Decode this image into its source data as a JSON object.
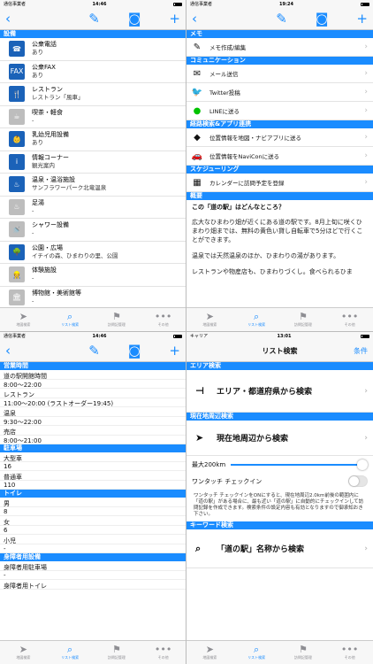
{
  "tl": {
    "status": {
      "carrier": "通信事業者",
      "time": "14:46"
    },
    "section": "設備",
    "facilities": [
      {
        "icon": "phone-icon",
        "glyph": "☎",
        "title": "公衆電話",
        "sub": "あり",
        "gray": false
      },
      {
        "icon": "fax-icon",
        "glyph": "FAX",
        "title": "公衆FAX",
        "sub": "あり",
        "gray": false
      },
      {
        "icon": "restaurant-icon",
        "glyph": "🍴",
        "title": "レストラン",
        "sub": "レストラン「風車」",
        "gray": false
      },
      {
        "icon": "cafe-icon",
        "glyph": "☕",
        "title": "喫茶・軽食",
        "sub": "-",
        "gray": true
      },
      {
        "icon": "baby-icon",
        "glyph": "👶",
        "title": "乳幼児用設備",
        "sub": "あり",
        "gray": false
      },
      {
        "icon": "info-icon",
        "glyph": "i",
        "title": "情報コーナー",
        "sub": "観光案内",
        "gray": false
      },
      {
        "icon": "onsen-icon",
        "glyph": "♨",
        "title": "温泉・温浴施設",
        "sub": "サンフラワーパーク北竜温泉",
        "gray": false
      },
      {
        "icon": "footbath-icon",
        "glyph": "♨",
        "title": "足湯",
        "sub": "-",
        "gray": true
      },
      {
        "icon": "shower-icon",
        "glyph": "🚿",
        "title": "シャワー設備",
        "sub": "-",
        "gray": true
      },
      {
        "icon": "park-icon",
        "glyph": "🌳",
        "title": "公園・広場",
        "sub": "イチイの森、ひまわりの里、公園",
        "gray": false
      },
      {
        "icon": "experience-icon",
        "glyph": "👷",
        "title": "体験施設",
        "sub": "-",
        "gray": true
      },
      {
        "icon": "museum-icon",
        "glyph": "🏛",
        "title": "博物館・美術館等",
        "sub": "-",
        "gray": true
      }
    ]
  },
  "tr": {
    "status": {
      "carrier": "通信事業者",
      "time": "19:24"
    },
    "sections": {
      "memo": "メモ",
      "communication": "コミュニケーション",
      "route": "経路検索&アプリ連携",
      "schedule": "スケジューリング",
      "summary": "概要"
    },
    "rows": {
      "memo": "メモ作成/編集",
      "mail": "メール送信",
      "twitter": "Twitter投稿",
      "line": "LINEに送る",
      "map": "位置情報を地図・ナビアプリに送る",
      "navicon": "位置情報をNaviConに送る",
      "calendar": "カレンダーに訪問予定を登録"
    },
    "summary_q": "この「道の駅」はどんなところ？",
    "paragraphs": [
      "広大なひまわり畑が近くにある道の駅です。8月上旬に咲くひまわり畑までは、無料の黄色い貸し自転車で5分ほどで行くことができます。",
      "温泉では天然温泉のほか、ひまわりの湯があります。",
      "レストランや物産店も、ひまわりづくし。食べられるひま"
    ]
  },
  "bl": {
    "status": {
      "carrier": "通信事業者",
      "time": "14:46"
    },
    "sections": {
      "hours": "営業時間",
      "parking": "駐車場",
      "toilet": "トイレ",
      "disabled": "身障者用設備"
    },
    "hours": [
      {
        "label": "道の駅開館時間",
        "value": "8:00～22:00"
      },
      {
        "label": "レストラン",
        "value": "11:00～20:00 (ラストオーダー19:45)"
      },
      {
        "label": "温泉",
        "value": "9:30～22:00"
      },
      {
        "label": "売店",
        "value": "8:00～21:00"
      }
    ],
    "parking": [
      {
        "label": "大型車",
        "value": "16"
      },
      {
        "label": "普通車",
        "value": "110"
      }
    ],
    "toilet": [
      {
        "label": "男",
        "value": "8"
      },
      {
        "label": "女",
        "value": "6"
      },
      {
        "label": "小児",
        "value": "-"
      }
    ],
    "disabled": [
      {
        "label": "身障者用駐車場",
        "value": "-"
      },
      {
        "label": "身障者用トイレ",
        "value": ""
      }
    ]
  },
  "br": {
    "status": {
      "carrier": "キャリア",
      "time": "13:01"
    },
    "title": "リスト検索",
    "right_label": "条件",
    "sections": {
      "area": "エリア検索",
      "nearby": "現在地周辺検索",
      "keyword": "キーワード検索"
    },
    "rows": {
      "area": "エリア・都道府県から検索",
      "nearby": "現在地周辺から検索",
      "keyword": "「道の駅」名称から検索"
    },
    "max_label": "最大200km",
    "toggle_label": "ワンタッチ チェックイン",
    "note": "ワンタッチ チェックインをONにすると、現在地周辺2.0km前後の範囲内に「道の駅」がある場合に、最も近い「道の駅」に自動的にチェックインして訪問記録を作成できます。検索条件の設定内容も有効となりますので御承知おき下さい。"
  },
  "tabs": [
    {
      "label": "地図検索",
      "icon": "location-arrow-icon",
      "glyph": "➤"
    },
    {
      "label": "リスト検索",
      "icon": "magnifier-icon",
      "glyph": "⌕"
    },
    {
      "label": "訪問記管理",
      "icon": "flag-icon",
      "glyph": "⚑"
    },
    {
      "label": "その他",
      "icon": "more-icon",
      "glyph": "•••"
    }
  ]
}
